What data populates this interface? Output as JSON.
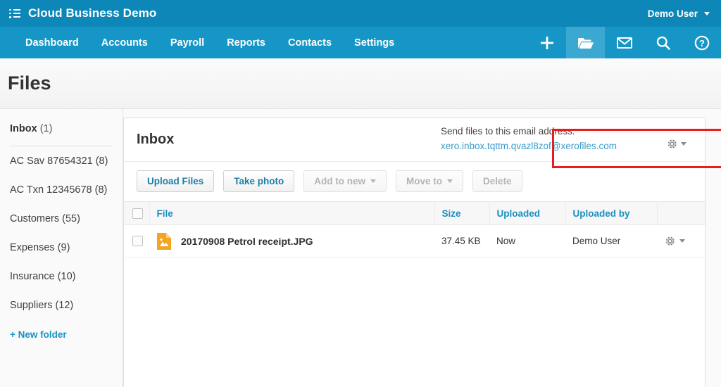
{
  "brand": {
    "menu_icon": "list-menu-icon",
    "title": "Cloud Business Demo",
    "user": "Demo User"
  },
  "nav": {
    "links": [
      {
        "label": "Dashboard"
      },
      {
        "label": "Accounts"
      },
      {
        "label": "Payroll"
      },
      {
        "label": "Reports"
      },
      {
        "label": "Contacts"
      },
      {
        "label": "Settings"
      }
    ],
    "icons": [
      {
        "name": "plus-icon",
        "active": false
      },
      {
        "name": "folder-icon",
        "active": true
      },
      {
        "name": "envelope-icon",
        "active": false
      },
      {
        "name": "search-icon",
        "active": false
      },
      {
        "name": "help-icon",
        "active": false
      }
    ]
  },
  "page": {
    "title": "Files"
  },
  "sidebar": {
    "inbox_label": "Inbox",
    "inbox_count": "(1)",
    "items": [
      {
        "label": "AC Sav 87654321 (8)"
      },
      {
        "label": "AC Txn 12345678 (8)"
      },
      {
        "label": "Customers (55)"
      },
      {
        "label": "Expenses (9)"
      },
      {
        "label": "Insurance (10)"
      },
      {
        "label": "Suppliers (12)"
      }
    ],
    "new_folder": "+ New folder"
  },
  "panel": {
    "title": "Inbox",
    "email_label": "Send files to this email address:",
    "email_address": "xero.inbox.tqttm.qvazl8zof@xerofiles.com",
    "highlight_color": "#e81d1d"
  },
  "toolbar": {
    "upload_files": "Upload Files",
    "take_photo": "Take photo",
    "add_to_new": "Add to new",
    "move_to": "Move to",
    "delete": "Delete"
  },
  "table": {
    "columns": [
      "File",
      "Size",
      "Uploaded",
      "Uploaded by"
    ],
    "rows": [
      {
        "file": "20170908 Petrol receipt.JPG",
        "size": "37.45 KB",
        "uploaded": "Now",
        "uploaded_by": "Demo User",
        "icon": "image-file-icon"
      }
    ]
  }
}
